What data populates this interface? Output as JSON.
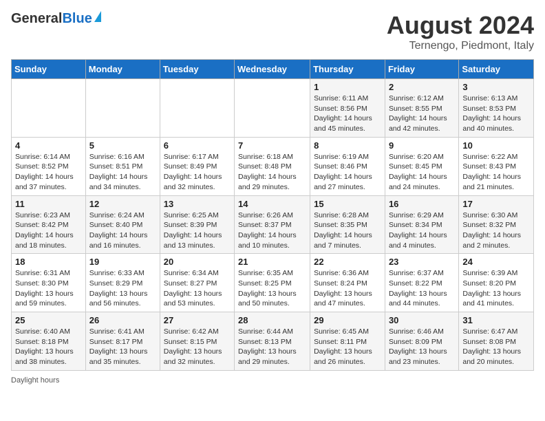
{
  "header": {
    "logo_general": "General",
    "logo_blue": "Blue",
    "title": "August 2024",
    "subtitle": "Ternengo, Piedmont, Italy"
  },
  "footer": {
    "daylight_label": "Daylight hours"
  },
  "days_of_week": [
    "Sunday",
    "Monday",
    "Tuesday",
    "Wednesday",
    "Thursday",
    "Friday",
    "Saturday"
  ],
  "weeks": [
    {
      "days": [
        {
          "num": "",
          "info": ""
        },
        {
          "num": "",
          "info": ""
        },
        {
          "num": "",
          "info": ""
        },
        {
          "num": "",
          "info": ""
        },
        {
          "num": "1",
          "info": "Sunrise: 6:11 AM\nSunset: 8:56 PM\nDaylight: 14 hours and 45 minutes."
        },
        {
          "num": "2",
          "info": "Sunrise: 6:12 AM\nSunset: 8:55 PM\nDaylight: 14 hours and 42 minutes."
        },
        {
          "num": "3",
          "info": "Sunrise: 6:13 AM\nSunset: 8:53 PM\nDaylight: 14 hours and 40 minutes."
        }
      ]
    },
    {
      "days": [
        {
          "num": "4",
          "info": "Sunrise: 6:14 AM\nSunset: 8:52 PM\nDaylight: 14 hours and 37 minutes."
        },
        {
          "num": "5",
          "info": "Sunrise: 6:16 AM\nSunset: 8:51 PM\nDaylight: 14 hours and 34 minutes."
        },
        {
          "num": "6",
          "info": "Sunrise: 6:17 AM\nSunset: 8:49 PM\nDaylight: 14 hours and 32 minutes."
        },
        {
          "num": "7",
          "info": "Sunrise: 6:18 AM\nSunset: 8:48 PM\nDaylight: 14 hours and 29 minutes."
        },
        {
          "num": "8",
          "info": "Sunrise: 6:19 AM\nSunset: 8:46 PM\nDaylight: 14 hours and 27 minutes."
        },
        {
          "num": "9",
          "info": "Sunrise: 6:20 AM\nSunset: 8:45 PM\nDaylight: 14 hours and 24 minutes."
        },
        {
          "num": "10",
          "info": "Sunrise: 6:22 AM\nSunset: 8:43 PM\nDaylight: 14 hours and 21 minutes."
        }
      ]
    },
    {
      "days": [
        {
          "num": "11",
          "info": "Sunrise: 6:23 AM\nSunset: 8:42 PM\nDaylight: 14 hours and 18 minutes."
        },
        {
          "num": "12",
          "info": "Sunrise: 6:24 AM\nSunset: 8:40 PM\nDaylight: 14 hours and 16 minutes."
        },
        {
          "num": "13",
          "info": "Sunrise: 6:25 AM\nSunset: 8:39 PM\nDaylight: 14 hours and 13 minutes."
        },
        {
          "num": "14",
          "info": "Sunrise: 6:26 AM\nSunset: 8:37 PM\nDaylight: 14 hours and 10 minutes."
        },
        {
          "num": "15",
          "info": "Sunrise: 6:28 AM\nSunset: 8:35 PM\nDaylight: 14 hours and 7 minutes."
        },
        {
          "num": "16",
          "info": "Sunrise: 6:29 AM\nSunset: 8:34 PM\nDaylight: 14 hours and 4 minutes."
        },
        {
          "num": "17",
          "info": "Sunrise: 6:30 AM\nSunset: 8:32 PM\nDaylight: 14 hours and 2 minutes."
        }
      ]
    },
    {
      "days": [
        {
          "num": "18",
          "info": "Sunrise: 6:31 AM\nSunset: 8:30 PM\nDaylight: 13 hours and 59 minutes."
        },
        {
          "num": "19",
          "info": "Sunrise: 6:33 AM\nSunset: 8:29 PM\nDaylight: 13 hours and 56 minutes."
        },
        {
          "num": "20",
          "info": "Sunrise: 6:34 AM\nSunset: 8:27 PM\nDaylight: 13 hours and 53 minutes."
        },
        {
          "num": "21",
          "info": "Sunrise: 6:35 AM\nSunset: 8:25 PM\nDaylight: 13 hours and 50 minutes."
        },
        {
          "num": "22",
          "info": "Sunrise: 6:36 AM\nSunset: 8:24 PM\nDaylight: 13 hours and 47 minutes."
        },
        {
          "num": "23",
          "info": "Sunrise: 6:37 AM\nSunset: 8:22 PM\nDaylight: 13 hours and 44 minutes."
        },
        {
          "num": "24",
          "info": "Sunrise: 6:39 AM\nSunset: 8:20 PM\nDaylight: 13 hours and 41 minutes."
        }
      ]
    },
    {
      "days": [
        {
          "num": "25",
          "info": "Sunrise: 6:40 AM\nSunset: 8:18 PM\nDaylight: 13 hours and 38 minutes."
        },
        {
          "num": "26",
          "info": "Sunrise: 6:41 AM\nSunset: 8:17 PM\nDaylight: 13 hours and 35 minutes."
        },
        {
          "num": "27",
          "info": "Sunrise: 6:42 AM\nSunset: 8:15 PM\nDaylight: 13 hours and 32 minutes."
        },
        {
          "num": "28",
          "info": "Sunrise: 6:44 AM\nSunset: 8:13 PM\nDaylight: 13 hours and 29 minutes."
        },
        {
          "num": "29",
          "info": "Sunrise: 6:45 AM\nSunset: 8:11 PM\nDaylight: 13 hours and 26 minutes."
        },
        {
          "num": "30",
          "info": "Sunrise: 6:46 AM\nSunset: 8:09 PM\nDaylight: 13 hours and 23 minutes."
        },
        {
          "num": "31",
          "info": "Sunrise: 6:47 AM\nSunset: 8:08 PM\nDaylight: 13 hours and 20 minutes."
        }
      ]
    }
  ]
}
